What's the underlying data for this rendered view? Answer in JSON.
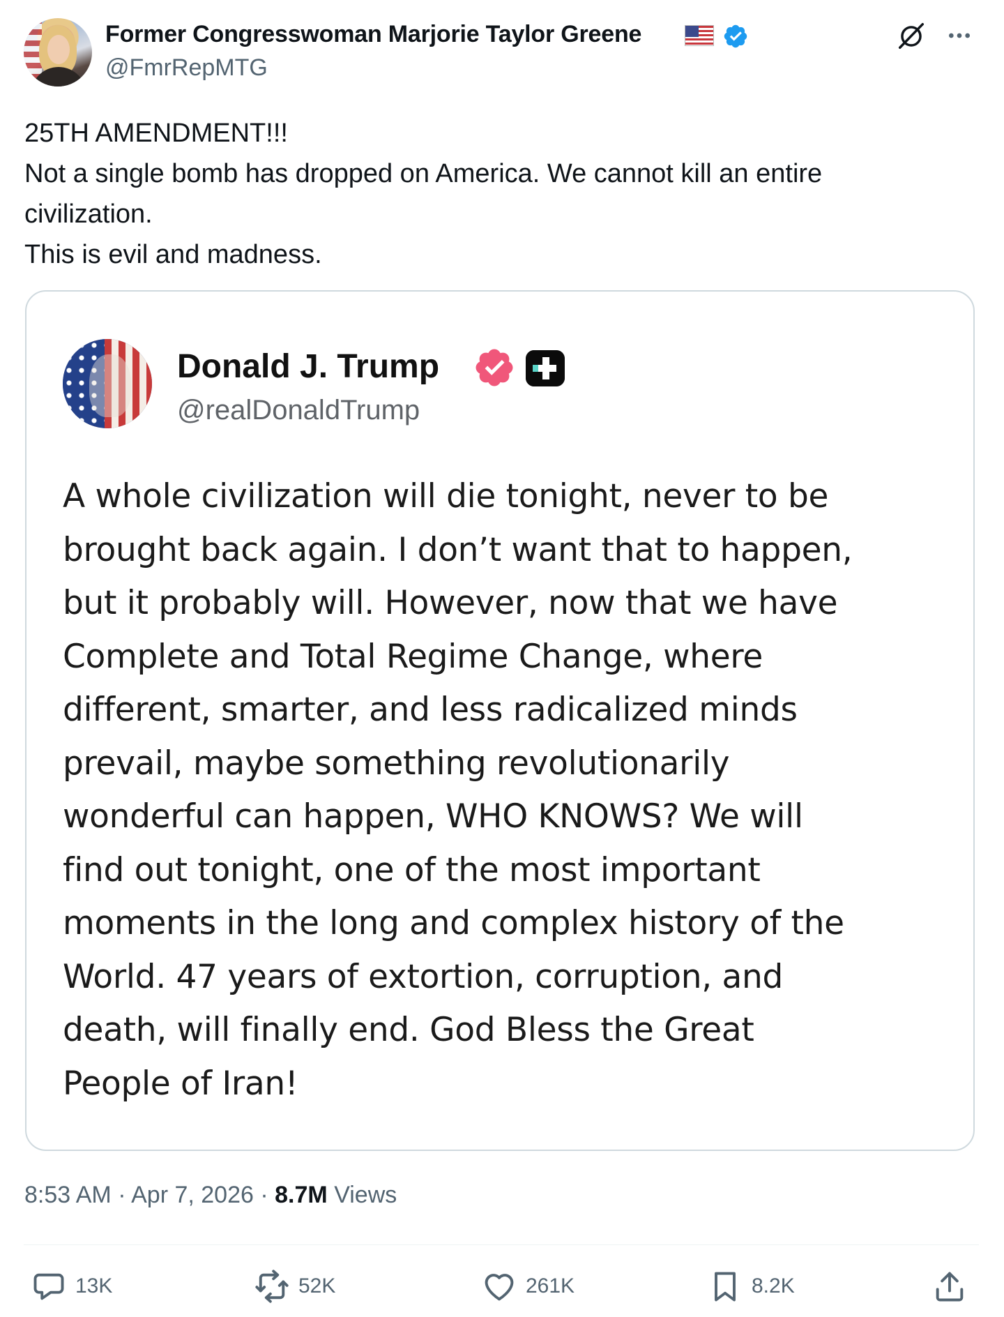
{
  "author": {
    "display_name": "Former Congresswoman Marjorie Taylor Greene",
    "handle": "@FmrRepMTG",
    "name_emoji": "us-flag-icon",
    "verified": "blue-verified-icon"
  },
  "tweet": {
    "lines": [
      "25TH AMENDMENT!!!",
      "Not a single bomb has dropped on America. We cannot kill an entire",
      "civilization.",
      "This is evil and madness."
    ]
  },
  "quoted": {
    "display_name": "Donald J. Trump",
    "handle": "@realDonaldTrump",
    "badges": [
      "pink-verified-icon",
      "truth-social-plus-icon"
    ],
    "lines": [
      "A whole civilization will die tonight, never to be",
      "brought back again. I don’t want that to happen,",
      "but it probably will. However, now that we have",
      "Complete and Total Regime Change, where",
      "different, smarter, and less radicalized minds",
      "prevail, maybe something revolutionarily",
      "wonderful can happen, WHO KNOWS? We will",
      "find out tonight, one of the most important",
      "moments in the long and complex history of the",
      "World. 47 years of extortion, corruption, and",
      "death, will finally end. God Bless the Great",
      "People of Iran!"
    ]
  },
  "meta": {
    "time": "8:53 AM",
    "separator": "·",
    "date": "Apr 7, 2026",
    "views_count": "8.7M",
    "views_label": "Views"
  },
  "actions": {
    "replies": "13K",
    "reposts": "52K",
    "likes": "261K",
    "bookmarks": "8.2K"
  },
  "colors": {
    "text_primary": "#0f1419",
    "text_secondary": "#536471",
    "verified_blue": "#1d9bf0",
    "verified_pink": "#f0577a",
    "border": "#cfd9de"
  }
}
